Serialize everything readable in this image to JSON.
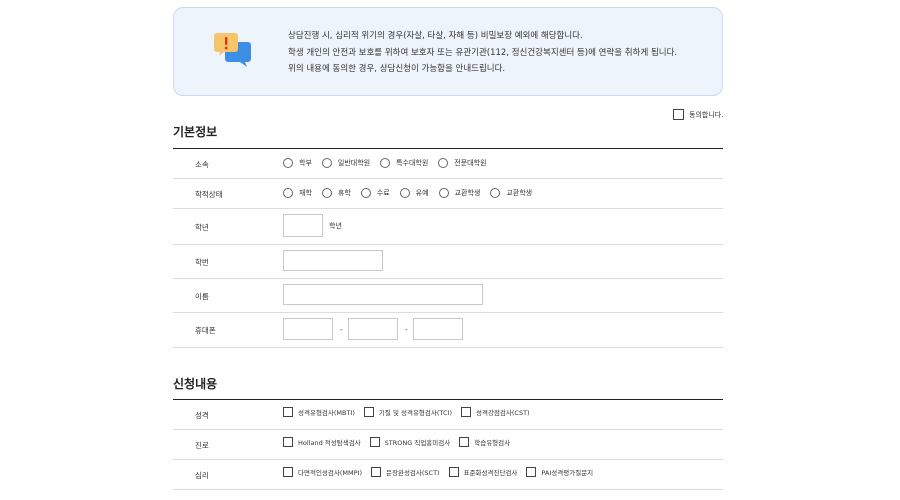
{
  "notice": {
    "icon": "alert-chat-bubble-icon",
    "lines": [
      "상담진행 시, 심리적 위기의 경우(자살, 타살, 자해 등) 비밀보장 예외에 해당합니다.",
      "학생 개인의 안전과 보호를 위하여 보호자 또는 유관기관(112, 정신건강복지센터 등)에 연락을 취하게 됩니다.",
      "위의 내용에 동의한 경우, 상담신청이 가능함을 안내드립니다."
    ]
  },
  "agree": {
    "label": "동의합니다."
  },
  "basic_info": {
    "title": "기본정보",
    "affiliation": {
      "label": "소속",
      "options": [
        "학부",
        "일반대학원",
        "특수대학원",
        "전문대학원"
      ]
    },
    "status": {
      "label": "학적상태",
      "options": [
        "재학",
        "휴학",
        "수료",
        "유예",
        "교환학생",
        "교환학생"
      ]
    },
    "grade": {
      "label": "학년",
      "suffix": "학년"
    },
    "student_id": {
      "label": "학번"
    },
    "name": {
      "label": "이름"
    },
    "phone": {
      "label": "휴대폰",
      "separator": "-"
    }
  },
  "application": {
    "title": "신청내용",
    "personality": {
      "label": "성격",
      "options": [
        "성격유형검사(MBTI)",
        "기질 및 성격유형검사(TCI)",
        "성격강점검사(CST)"
      ]
    },
    "career": {
      "label": "진로",
      "options": [
        "Holland 적성탐색검사",
        "STRONG 직업흥미검사",
        "학습유형검사"
      ]
    },
    "psych": {
      "label": "심리",
      "options": [
        "다면적인성검사(MMPI)",
        "문장완성검사(SCT)",
        "표준화성격진단검사",
        "PAI성격평가질문지"
      ]
    }
  }
}
